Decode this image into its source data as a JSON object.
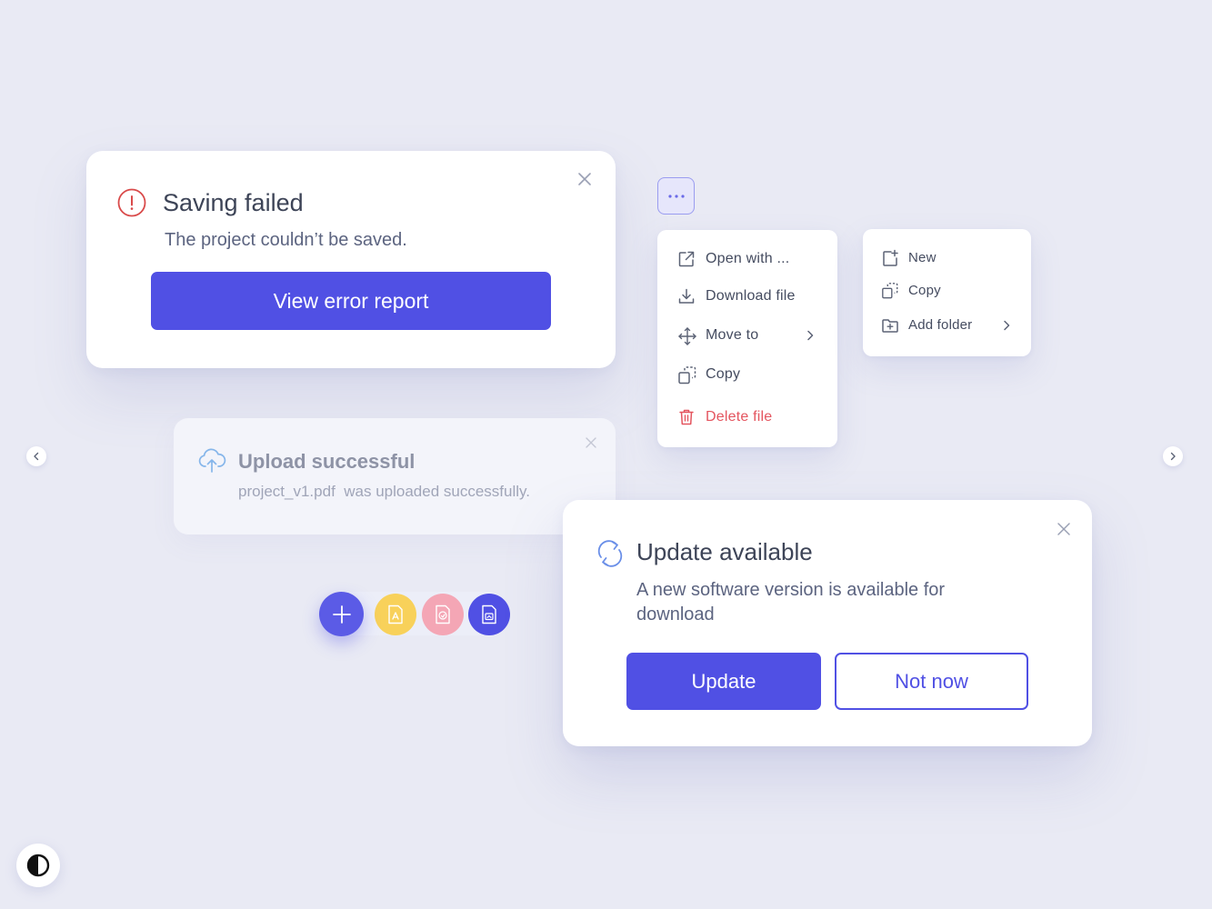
{
  "colors": {
    "background": "#e9eaf4",
    "primary": "#5050e4",
    "error": "#d94a4a",
    "danger_text": "#e4555f"
  },
  "error_card": {
    "title": "Saving failed",
    "message": "The project couldn’t be saved.",
    "button_label": "View error report",
    "icon": "alert-circle-icon"
  },
  "upload_card": {
    "title": "Upload successful",
    "message": "project_v1.pdf  was uploaded successfully.",
    "icon": "cloud-upload-icon"
  },
  "more_button": {
    "label": "···"
  },
  "context_menu": {
    "items": [
      {
        "label": "Open with ...",
        "icon": "external-link-icon"
      },
      {
        "label": "Download file",
        "icon": "download-icon"
      },
      {
        "label": "Move to",
        "icon": "move-icon",
        "has_submenu": true
      },
      {
        "label": "Copy",
        "icon": "copy-icon"
      },
      {
        "label": "Delete file",
        "icon": "trash-icon",
        "danger": true
      }
    ]
  },
  "submenu": {
    "items": [
      {
        "label": "New",
        "icon": "new-file-icon"
      },
      {
        "label": "Copy",
        "icon": "copy-icon"
      },
      {
        "label": "Add folder",
        "icon": "add-folder-icon",
        "has_submenu": true
      }
    ]
  },
  "update_card": {
    "title": "Update available",
    "message": "A new software version is available for download",
    "primary_label": "Update",
    "secondary_label": "Not now",
    "icon": "refresh-icon"
  },
  "fab": {
    "add_icon": "plus-icon",
    "actions": [
      "pdf-file-icon",
      "image-file-icon",
      "doc-file-icon"
    ]
  },
  "nav": {
    "prev_icon": "chevron-left-icon",
    "next_icon": "chevron-right-icon"
  },
  "theme_toggle": {
    "icon": "contrast-icon"
  }
}
